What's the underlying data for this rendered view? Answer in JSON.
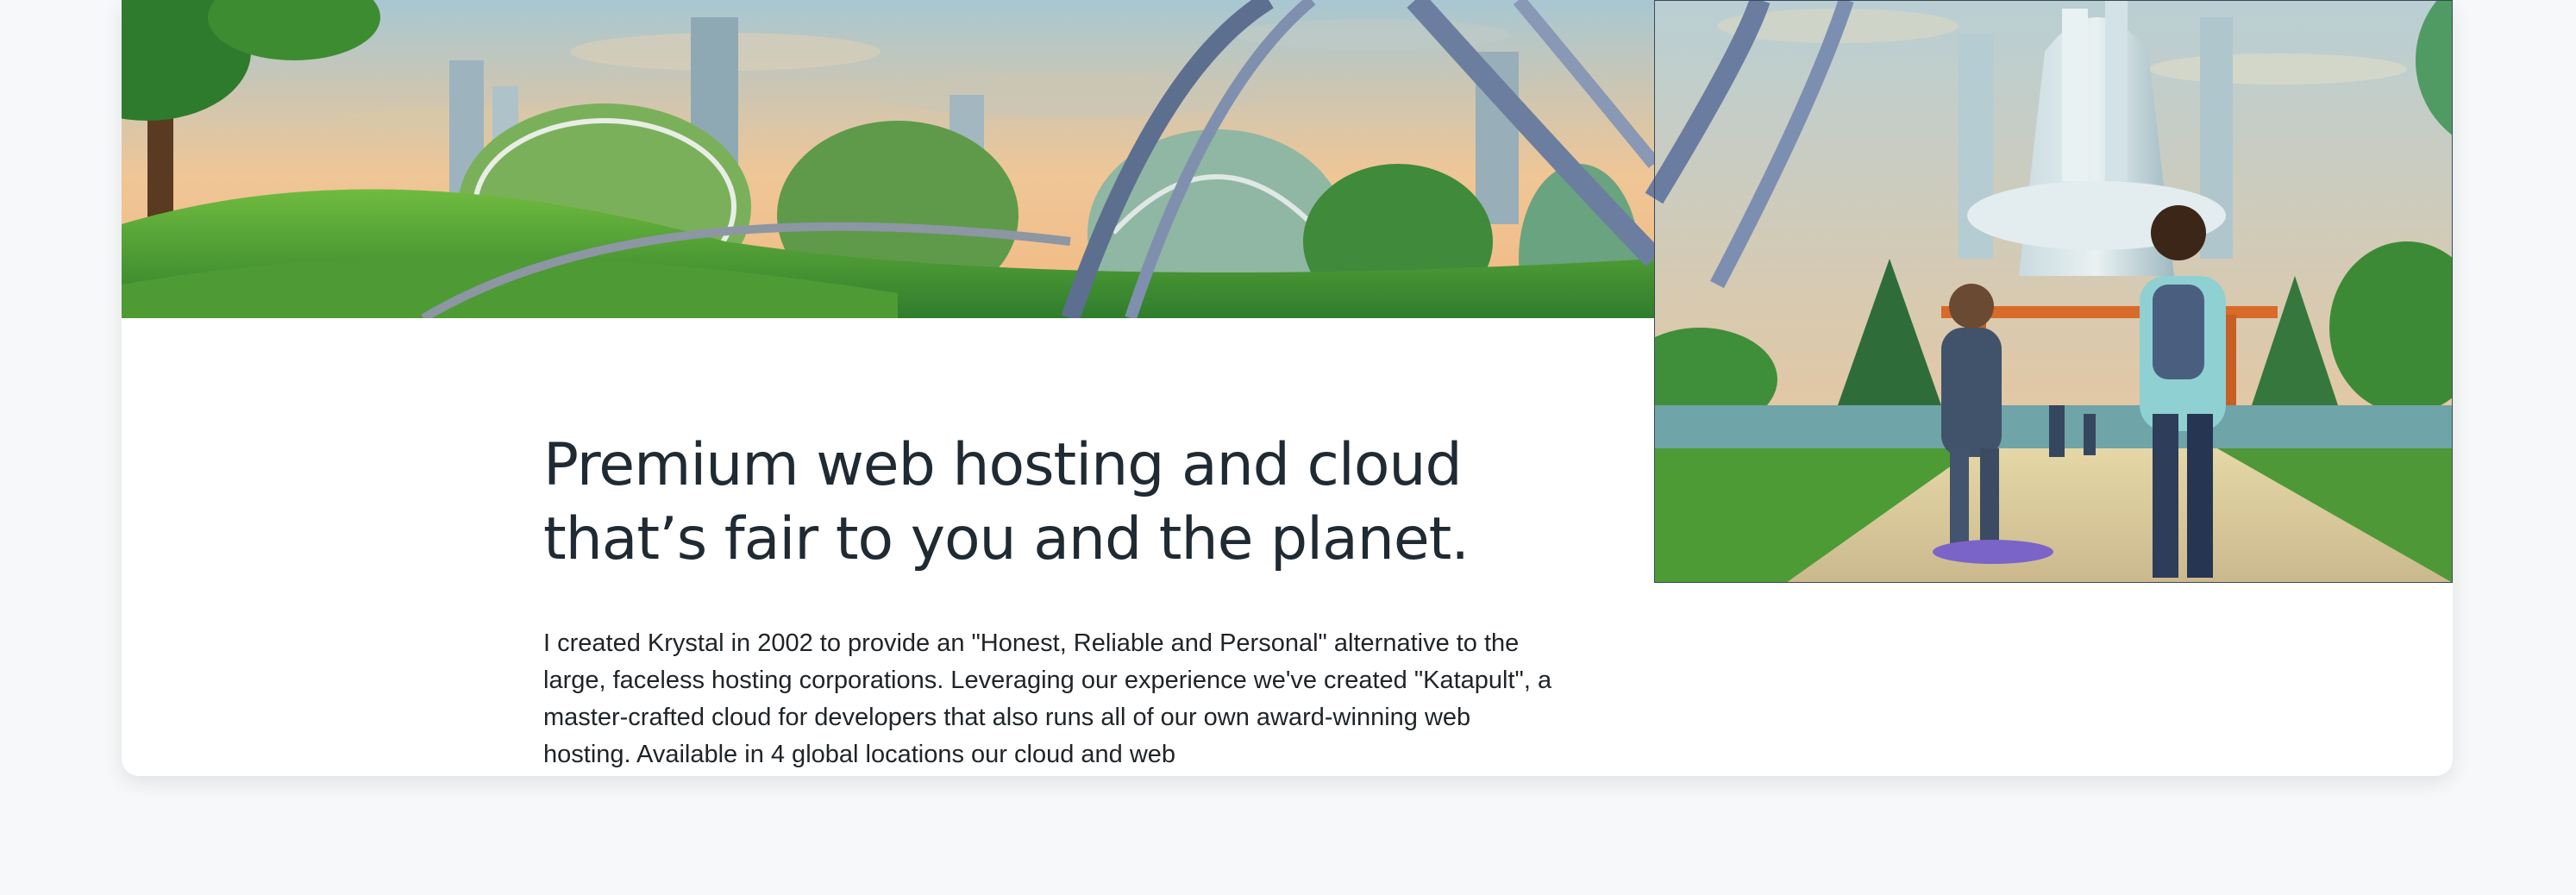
{
  "hero": {
    "headline_line1": "Premium web hosting and cloud",
    "headline_line2": "that’s fair to you and the planet.",
    "intro": "I created Krystal in 2002 to provide an \"Honest, Reliable and Personal\" alternative to the large, faceless hosting corporations. Leveraging our experience we've created \"Katapult\", a master-crafted cloud for developers that also runs all of our own award-winning web hosting. Available in 4 global locations our cloud and web"
  },
  "illustration": {
    "icon": "futuristic-green-city-illustration"
  },
  "zoom_button": {
    "icon": "zoom-in-icon"
  },
  "colors": {
    "page_background": "#f7f8f9",
    "card_background": "#ffffff",
    "headline_text": "#1f2a33",
    "button_background": "#27313b",
    "button_icon": "#ffffff"
  }
}
